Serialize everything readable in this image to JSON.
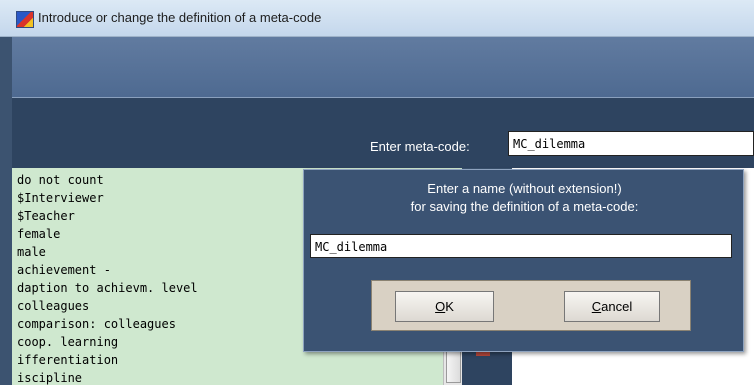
{
  "window": {
    "title": "Introduce or change the definition of a meta-code"
  },
  "meta": {
    "label": "Enter meta-code:",
    "value": "MC_dilemma"
  },
  "list": {
    "items": [
      "do not count",
      "$Interviewer",
      "$Teacher",
      "female",
      "male",
      "achievement -",
      "daption to achievm. level",
      "colleagues",
      "comparison: colleagues",
      "coop. learning",
      "ifferentiation",
      "iscipline"
    ]
  },
  "dialog": {
    "line1": "Enter a name (without extension!)",
    "line2": "for saving the definition of a meta-code:",
    "value": "MC_dilemma",
    "ok_accel": "O",
    "ok_rest": "K",
    "cancel_accel": "C",
    "cancel_rest": "ancel"
  },
  "colors": {
    "accent": "#3b5373",
    "list_bg": "#cfe8cf",
    "panel": "#d9d1c4"
  }
}
